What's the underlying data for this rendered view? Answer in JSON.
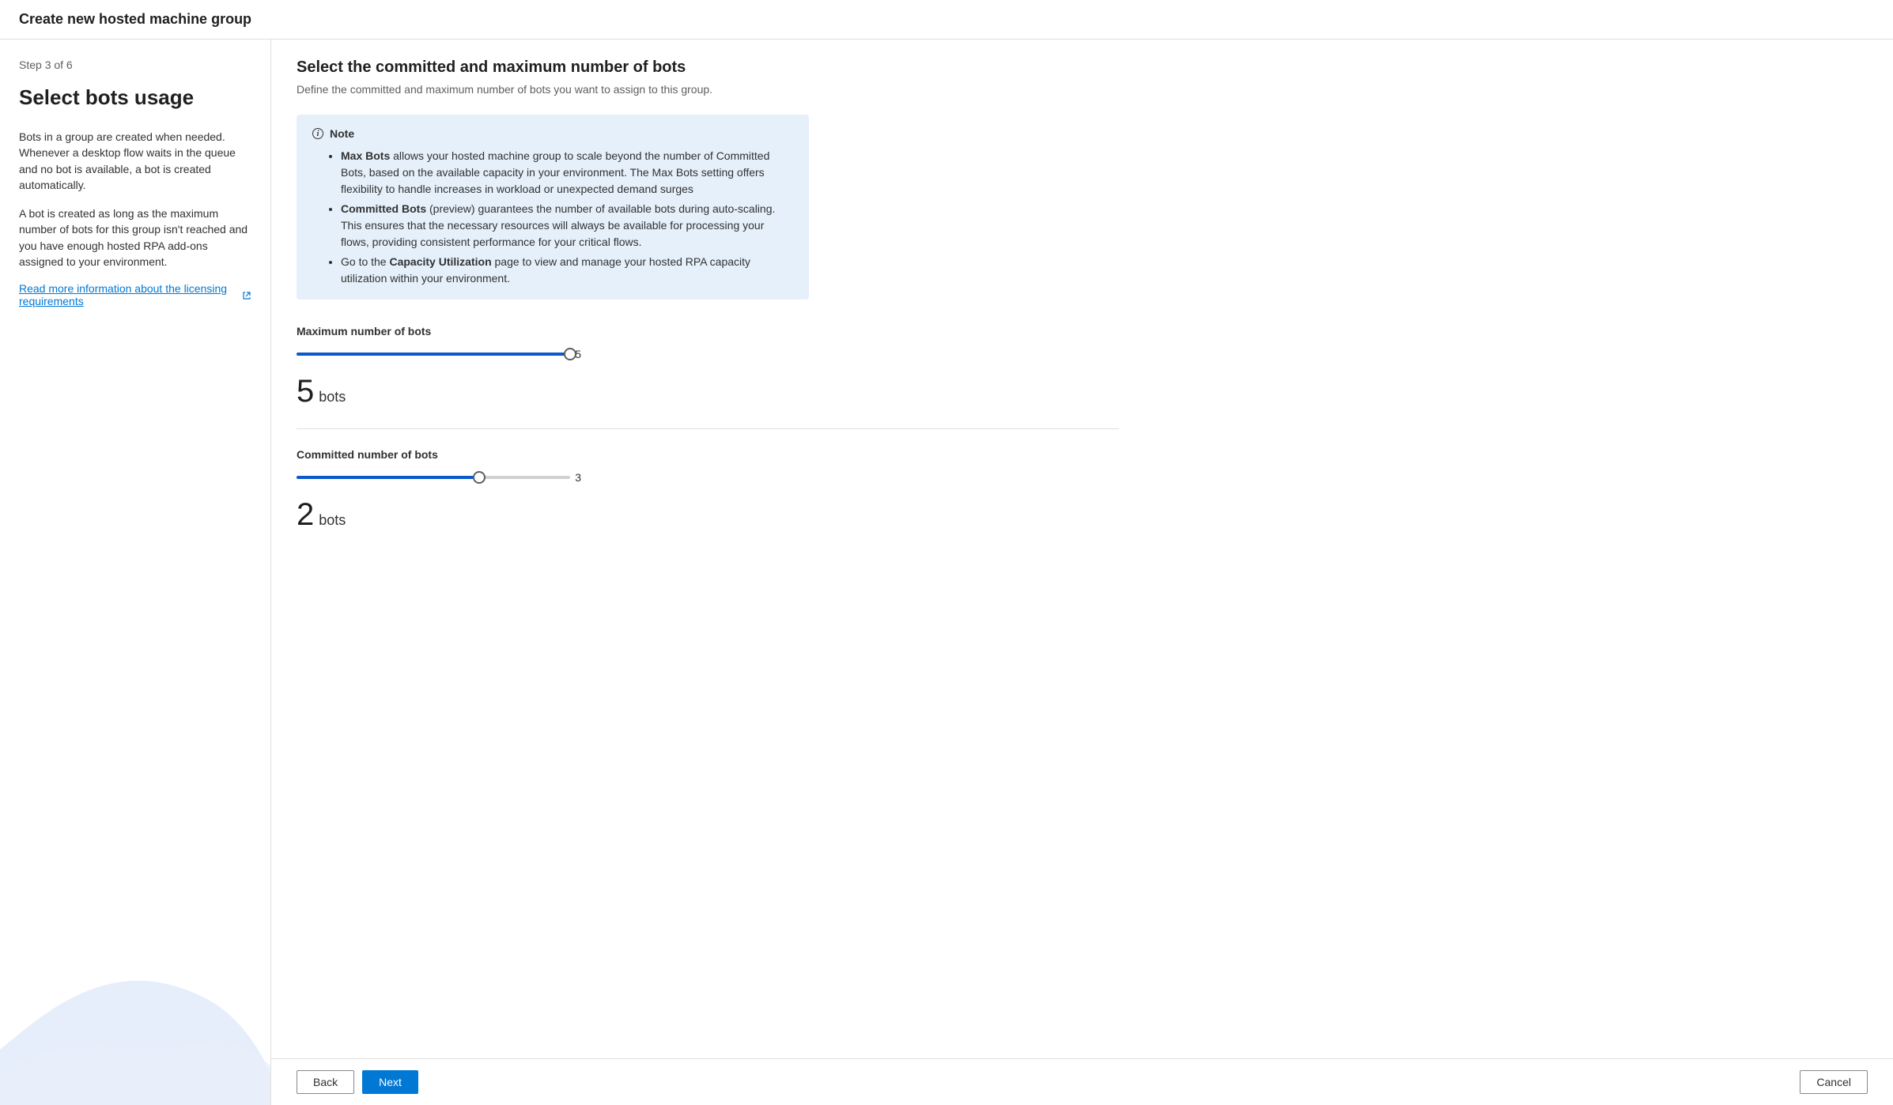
{
  "header": {
    "title": "Create new hosted machine group"
  },
  "sidebar": {
    "step_indicator": "Step 3 of 6",
    "title": "Select bots usage",
    "text1": "Bots in a group are created when needed. Whenever a desktop flow waits in the queue and no bot is available, a bot is created automatically.",
    "text2": "A bot is created as long as the maximum number of bots for this group isn't reached and you have enough hosted RPA add-ons assigned to your environment.",
    "link_text": "Read more information about the licensing requirements"
  },
  "main": {
    "title": "Select the committed and maximum number of bots",
    "subtitle": "Define the committed and maximum number of bots you want to assign to this group.",
    "note": {
      "label": "Note",
      "item1_bold": "Max Bots",
      "item1_rest": " allows your hosted machine group to scale beyond the number of Committed Bots, based on the available capacity in your environment. The Max Bots setting offers flexibility to handle increases in workload or unexpected demand surges",
      "item2_bold": "Committed Bots",
      "item2_rest": " (preview) guarantees the number of available bots during auto-scaling. This ensures that the necessary resources will always be available for processing your flows, providing consistent performance for your critical flows.",
      "item3_prefix": "Go to the ",
      "item3_bold": "Capacity Utilization",
      "item3_rest": " page to view and manage your hosted RPA capacity utilization within your environment."
    },
    "max_bots": {
      "label": "Maximum number of bots",
      "value": "5",
      "max_label": "5",
      "unit": "bots",
      "fill_percent": 100
    },
    "committed_bots": {
      "label": "Committed number of bots",
      "value": "2",
      "max_label": "3",
      "unit": "bots",
      "fill_percent": 66.6
    }
  },
  "footer": {
    "back": "Back",
    "next": "Next",
    "cancel": "Cancel"
  }
}
